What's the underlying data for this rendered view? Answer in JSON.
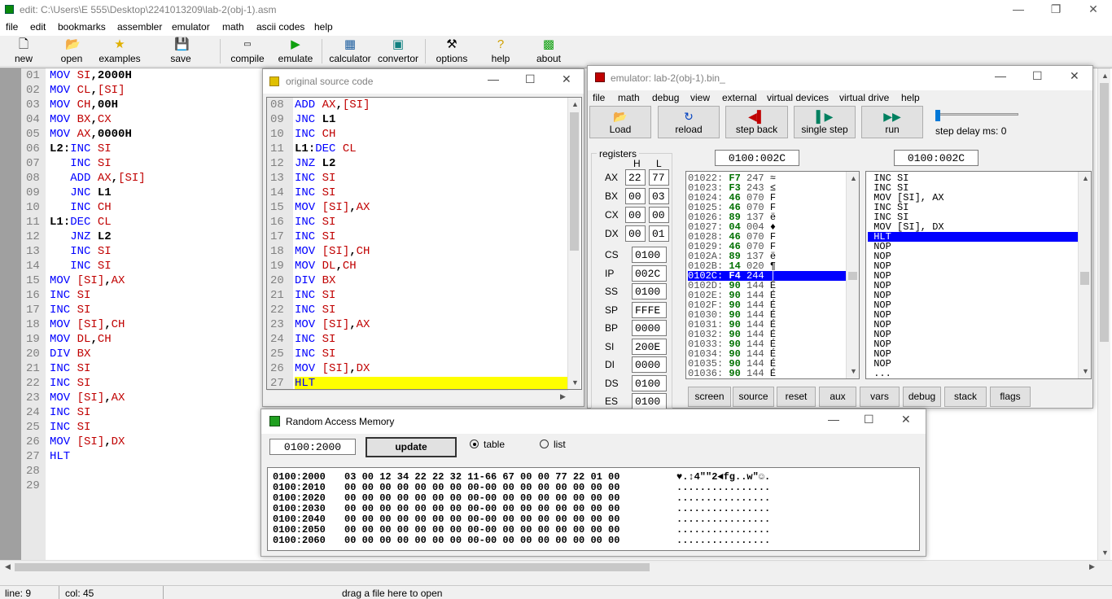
{
  "window": {
    "title": "edit: C:\\Users\\E 555\\Desktop\\2241013209\\lab-2(obj-1).asm"
  },
  "menu": [
    "file",
    "edit",
    "bookmarks",
    "assembler",
    "emulator",
    "math",
    "ascii codes",
    "help"
  ],
  "toolbar": {
    "new": "new",
    "open": "open",
    "examples": "examples",
    "save": "save",
    "compile": "compile",
    "emulate": "emulate",
    "calculator": "calculator",
    "convertor": "convertor",
    "options": "options",
    "help": "help",
    "about": "about"
  },
  "editor": {
    "line_numbers": [
      "01",
      "02",
      "03",
      "04",
      "05",
      "06",
      "07",
      "08",
      "09",
      "10",
      "11",
      "12",
      "13",
      "14",
      "15",
      "16",
      "17",
      "18",
      "19",
      "20",
      "21",
      "22",
      "23",
      "24",
      "25",
      "26",
      "27",
      "28",
      "29"
    ],
    "lines": [
      "MOV SI,2000H",
      "MOV CL,[SI]",
      "MOV CH,00H",
      "MOV BX,CX",
      "MOV AX,0000H",
      "L2:INC SI",
      "   INC SI",
      "   ADD AX,[SI]",
      "   JNC L1",
      "   INC CH",
      "L1:DEC CL",
      "   JNZ L2",
      "   INC SI",
      "   INC SI",
      "MOV [SI],AX",
      "INC SI",
      "INC SI",
      "MOV [SI],CH",
      "MOV DL,CH",
      "DIV BX",
      "INC SI",
      "INC SI",
      "MOV [SI],AX",
      "INC SI",
      "INC SI",
      "MOV [SI],DX",
      "HLT",
      "",
      ""
    ]
  },
  "status_bar": {
    "line": "line: 9",
    "col": "col: 45",
    "hint": "drag a file here to open"
  },
  "source_window": {
    "title": "original source code",
    "line_numbers": [
      "08",
      "09",
      "10",
      "11",
      "12",
      "13",
      "14",
      "15",
      "16",
      "17",
      "18",
      "19",
      "20",
      "21",
      "22",
      "23",
      "24",
      "25",
      "26",
      "27"
    ],
    "lines": [
      "ADD AX,[SI]",
      "JNC L1",
      "INC CH",
      "L1:DEC CL",
      "JNZ L2",
      "INC SI",
      "INC SI",
      "MOV [SI],AX",
      "INC SI",
      "INC SI",
      "MOV [SI],CH",
      "MOV DL,CH",
      "DIV BX",
      "INC SI",
      "INC SI",
      "MOV [SI],AX",
      "INC SI",
      "INC SI",
      "MOV [SI],DX",
      "HLT"
    ]
  },
  "emulator": {
    "title": "emulator: lab-2(obj-1).bin_",
    "menu": [
      "file",
      "math",
      "debug",
      "view",
      "external",
      "virtual devices",
      "virtual drive",
      "help"
    ],
    "buttons": {
      "load": "Load",
      "reload": "reload",
      "step_back": "step back",
      "single_step": "single step",
      "run": "run"
    },
    "step_delay": "step delay ms: 0",
    "registers_title": "registers",
    "h_label": "H",
    "l_label": "L",
    "regs_hl": [
      {
        "name": "AX",
        "h": "22",
        "l": "77"
      },
      {
        "name": "BX",
        "h": "00",
        "l": "03"
      },
      {
        "name": "CX",
        "h": "00",
        "l": "00"
      },
      {
        "name": "DX",
        "h": "00",
        "l": "01"
      }
    ],
    "regs": [
      {
        "name": "CS",
        "value": "0100"
      },
      {
        "name": "IP",
        "value": "002C"
      },
      {
        "name": "SS",
        "value": "0100"
      },
      {
        "name": "SP",
        "value": "FFFE"
      },
      {
        "name": "BP",
        "value": "0000"
      },
      {
        "name": "SI",
        "value": "200E"
      },
      {
        "name": "DI",
        "value": "0000"
      },
      {
        "name": "DS",
        "value": "0100"
      },
      {
        "name": "ES",
        "value": "0100"
      }
    ],
    "addr1": "0100:002C",
    "addr2": "0100:002C",
    "memory": [
      {
        "addr": "01022:",
        "hex": "F7",
        "dec": "247",
        "ch": "≈"
      },
      {
        "addr": "01023:",
        "hex": "F3",
        "dec": "243",
        "ch": "≤"
      },
      {
        "addr": "01024:",
        "hex": "46",
        "dec": "070",
        "ch": "F"
      },
      {
        "addr": "01025:",
        "hex": "46",
        "dec": "070",
        "ch": "F"
      },
      {
        "addr": "01026:",
        "hex": "89",
        "dec": "137",
        "ch": "ë"
      },
      {
        "addr": "01027:",
        "hex": "04",
        "dec": "004",
        "ch": "♦"
      },
      {
        "addr": "01028:",
        "hex": "46",
        "dec": "070",
        "ch": "F"
      },
      {
        "addr": "01029:",
        "hex": "46",
        "dec": "070",
        "ch": "F"
      },
      {
        "addr": "0102A:",
        "hex": "89",
        "dec": "137",
        "ch": "ë"
      },
      {
        "addr": "0102B:",
        "hex": "14",
        "dec": "020",
        "ch": "¶"
      },
      {
        "addr": "0102C:",
        "hex": "F4",
        "dec": "244",
        "ch": "⌠"
      },
      {
        "addr": "0102D:",
        "hex": "90",
        "dec": "144",
        "ch": "É"
      },
      {
        "addr": "0102E:",
        "hex": "90",
        "dec": "144",
        "ch": "É"
      },
      {
        "addr": "0102F:",
        "hex": "90",
        "dec": "144",
        "ch": "É"
      },
      {
        "addr": "01030:",
        "hex": "90",
        "dec": "144",
        "ch": "É"
      },
      {
        "addr": "01031:",
        "hex": "90",
        "dec": "144",
        "ch": "É"
      },
      {
        "addr": "01032:",
        "hex": "90",
        "dec": "144",
        "ch": "É"
      },
      {
        "addr": "01033:",
        "hex": "90",
        "dec": "144",
        "ch": "É"
      },
      {
        "addr": "01034:",
        "hex": "90",
        "dec": "144",
        "ch": "É"
      },
      {
        "addr": "01035:",
        "hex": "90",
        "dec": "144",
        "ch": "É"
      },
      {
        "addr": "01036:",
        "hex": "90",
        "dec": "144",
        "ch": "É"
      }
    ],
    "selected_memory_index": 10,
    "disasm": [
      "INC SI",
      "INC SI",
      "MOV [SI], AX",
      "INC SI",
      "INC SI",
      "MOV [SI], DX",
      "HLT",
      "NOP",
      "NOP",
      "NOP",
      "NOP",
      "NOP",
      "NOP",
      "NOP",
      "NOP",
      "NOP",
      "NOP",
      "NOP",
      "NOP",
      "NOP",
      "..."
    ],
    "selected_disasm_index": 6,
    "bottom_buttons": [
      "screen",
      "source",
      "reset",
      "aux",
      "vars",
      "debug",
      "stack",
      "flags"
    ]
  },
  "ram_window": {
    "title": "Random Access Memory",
    "address": "0100:2000",
    "update": "update",
    "table_label": "table",
    "list_label": "list",
    "rows": [
      {
        "addr": "0100:2000",
        "bytes": "03 00 12 34 22 22 32 11-66 67 00 00 77 22 01 00",
        "ascii": "♥.↕4\"\"2◄fg..w\"☺."
      },
      {
        "addr": "0100:2010",
        "bytes": "00 00 00 00 00 00 00 00-00 00 00 00 00 00 00 00",
        "ascii": "................"
      },
      {
        "addr": "0100:2020",
        "bytes": "00 00 00 00 00 00 00 00-00 00 00 00 00 00 00 00",
        "ascii": "................"
      },
      {
        "addr": "0100:2030",
        "bytes": "00 00 00 00 00 00 00 00-00 00 00 00 00 00 00 00",
        "ascii": "................"
      },
      {
        "addr": "0100:2040",
        "bytes": "00 00 00 00 00 00 00 00-00 00 00 00 00 00 00 00",
        "ascii": "................"
      },
      {
        "addr": "0100:2050",
        "bytes": "00 00 00 00 00 00 00 00-00 00 00 00 00 00 00 00",
        "ascii": "................"
      },
      {
        "addr": "0100:2060",
        "bytes": "00 00 00 00 00 00 00 00-00 00 00 00 00 00 00 00",
        "ascii": "................"
      }
    ]
  },
  "colors": {
    "keyword": "#0000ff",
    "register": "#c00000",
    "highlight": "#ffff00",
    "selection": "#0000ff",
    "hexgreen": "#007000"
  }
}
